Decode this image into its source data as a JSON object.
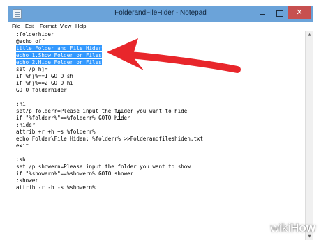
{
  "window": {
    "title": "FolderandFileHider - Notepad",
    "close_glyph": "✕"
  },
  "menu": {
    "file": "File",
    "edit": "Edit",
    "format": "Format",
    "view": "View",
    "help": "Help"
  },
  "editor": {
    "lines": [
      ":folderhider",
      "@echo off",
      "title Folder and File Hider",
      "echo 1.Show Folder or Files",
      "echo 2.Hide Folder or Files",
      "set /p hj=",
      "if %hj%==1 GOTO sh",
      "if %hj%==2 GOTO hi",
      "GOTO folderhider",
      "",
      ":hi",
      "set/p folderr=Please input the folder you want to hide",
      "if \"%folderr%\"==%folderr% GOTO hider",
      ":hider",
      "attrib +r +h +s %folderr%",
      "echo Folder\\File Hiden: %folderr% >>Folderandfileshiden.txt",
      "exit",
      "",
      ":sh",
      "set /p showern=Please input the folder you want to show",
      "if \"%showern%\"==%showern% GOTO shower",
      ":shower",
      "attrib -r -h -s %showern%"
    ],
    "selected_lines": [
      2,
      3,
      4
    ],
    "selection_color": "#3399ff"
  },
  "annotation": {
    "arrow_color": "#e8262b"
  },
  "watermark": {
    "prefix": "wiki",
    "suffix": "How"
  }
}
